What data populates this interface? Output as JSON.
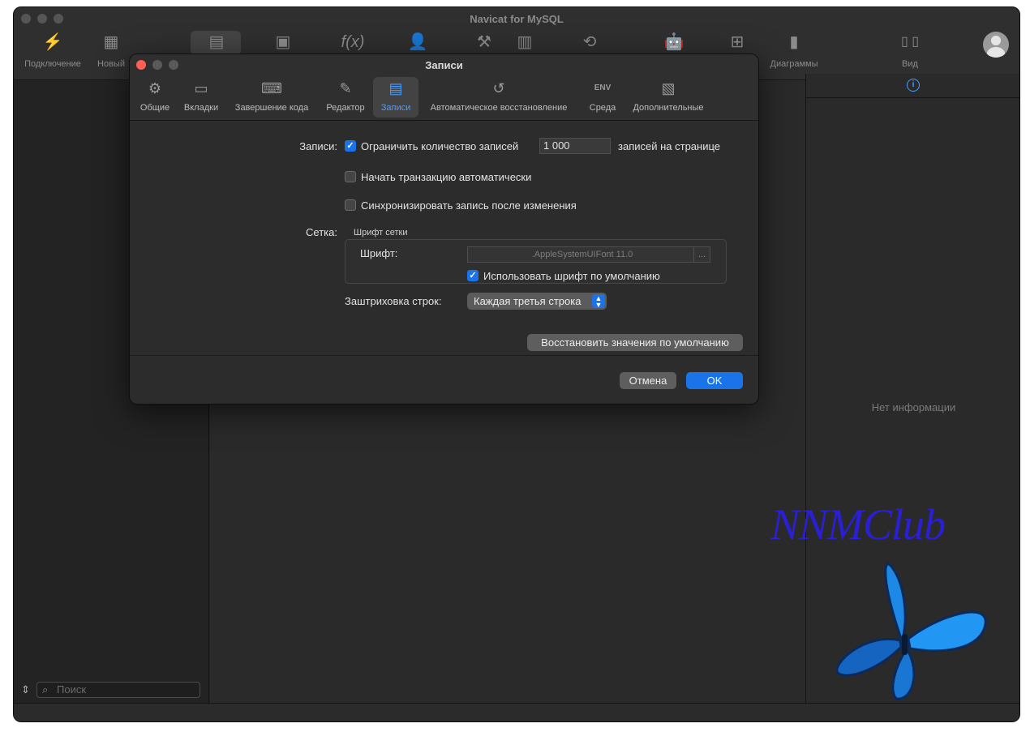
{
  "app": {
    "title": "Navicat for MySQL",
    "toolbar": [
      {
        "label": "Подключение",
        "icon": "connection-icon"
      },
      {
        "label": "Новый",
        "icon": "new-query-icon"
      },
      {
        "label": "",
        "icon": "table-icon"
      },
      {
        "label": "",
        "icon": "view-icon"
      },
      {
        "label": "",
        "icon": "function-icon"
      },
      {
        "label": "",
        "icon": "user-icon"
      },
      {
        "label": "",
        "icon": "tools-icon"
      },
      {
        "label": "",
        "icon": "query-icon"
      },
      {
        "label": "",
        "icon": "backup-icon"
      },
      {
        "label": "",
        "icon": "automation-icon"
      },
      {
        "label": "",
        "icon": "model-icon"
      },
      {
        "label": "Диаграммы",
        "icon": "charts-icon"
      },
      {
        "label": "Вид",
        "icon": "view-toggle-icon"
      }
    ],
    "search_placeholder": "Поиск",
    "right_panel": {
      "no_info": "Нет информации"
    }
  },
  "dialog": {
    "title": "Записи",
    "tabs": [
      {
        "label": "Общие",
        "icon": "gear-icon"
      },
      {
        "label": "Вкладки",
        "icon": "tabs-icon"
      },
      {
        "label": "Завершение кода",
        "icon": "code-completion-icon"
      },
      {
        "label": "Редактор",
        "icon": "editor-icon"
      },
      {
        "label": "Записи",
        "icon": "records-icon",
        "active": true
      },
      {
        "label": "Автоматическое восстановление",
        "icon": "history-icon"
      },
      {
        "label": "Среда",
        "icon": "env-icon"
      },
      {
        "label": "Дополнительные",
        "icon": "advanced-icon"
      }
    ],
    "records": {
      "section_label": "Записи:",
      "limit_label": "Ограничить количество записей",
      "limit_checked": true,
      "limit_value": "1 000",
      "per_page_label": "записей на странице",
      "auto_transaction_label": "Начать транзакцию автоматически",
      "auto_transaction_checked": false,
      "sync_label": "Синхронизировать запись после изменения",
      "sync_checked": false
    },
    "grid": {
      "section_label": "Сетка:",
      "group_title": "Шрифт сетки",
      "font_label": "Шрифт:",
      "font_value": ".AppleSystemUIFont 11.0",
      "font_button": "...",
      "default_font_label": "Использовать шрифт по умолчанию",
      "default_font_checked": true,
      "shading_label": "Заштриховка строк:",
      "shading_value": "Каждая третья строка"
    },
    "restore_defaults": "Восстановить значения по умолчанию",
    "cancel": "Отмена",
    "ok": "OK"
  },
  "watermark": {
    "text": "NNMClub"
  },
  "colors": {
    "accent": "#1a73e8",
    "close": "#ff5f57",
    "watermark": "#2b1fd6",
    "butterfly": "#1e88e5"
  }
}
